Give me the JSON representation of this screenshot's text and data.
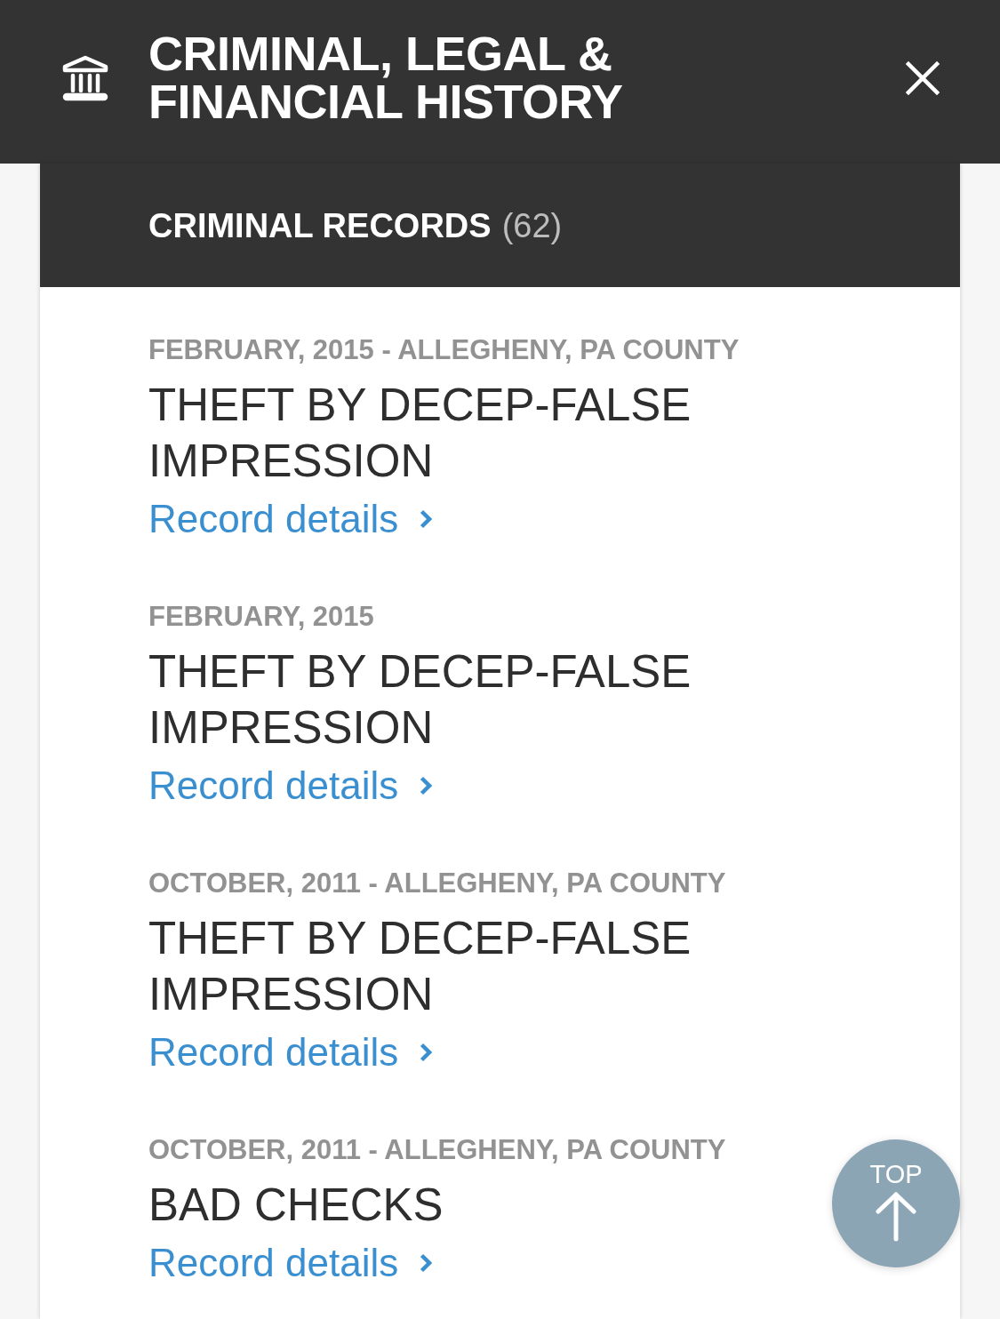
{
  "header": {
    "title": "CRIMINAL, LEGAL & FINANCIAL HISTORY"
  },
  "section": {
    "title": "CRIMINAL RECORDS",
    "count": "(62)"
  },
  "records": [
    {
      "meta": "FEBRUARY, 2015 - ALLEGHENY, PA COUNTY",
      "title": "THEFT BY DECEP-FALSE IMPRESSION",
      "link": "Record details"
    },
    {
      "meta": "FEBRUARY, 2015",
      "title": "THEFT BY DECEP-FALSE IMPRESSION",
      "link": "Record details"
    },
    {
      "meta": "OCTOBER, 2011 - ALLEGHENY, PA COUNTY",
      "title": "THEFT BY DECEP-FALSE IMPRESSION",
      "link": "Record details"
    },
    {
      "meta": "OCTOBER, 2011 - ALLEGHENY, PA COUNTY",
      "title": "BAD CHECKS",
      "link": "Record details"
    }
  ],
  "top_button": {
    "label": "TOP"
  }
}
